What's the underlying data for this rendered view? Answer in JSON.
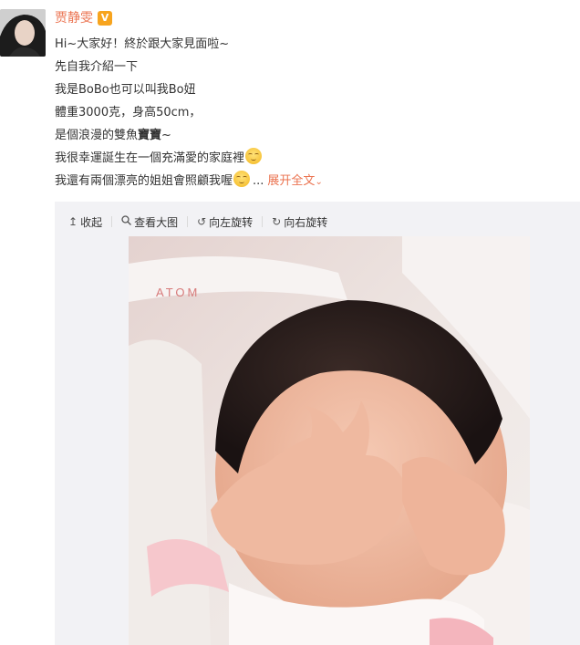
{
  "author": {
    "name": "贾静雯",
    "badge": "V"
  },
  "post": {
    "lines": [
      "Hi~大家好！終於跟大家見面啦~",
      "先自我介紹一下",
      "我是BoBo也可以叫我Bo妞",
      "體重3000克，身高50cm，",
      "是個浪漫的雙魚"
    ],
    "line5_bold": "寶寶",
    "line5_tail": "~",
    "line6": "我很幸運誕生在一個充滿愛的家庭裡",
    "line7": "我還有兩個漂亮的姐姐會照顧我喔",
    "ellipsis": "...",
    "expand_label": "展开全文",
    "expand_chevron": "⌄"
  },
  "toolbar": {
    "collapse_label": "收起",
    "view_large_label": "查看大图",
    "rotate_left_label": "向左旋转",
    "rotate_right_label": "向右旋转"
  },
  "icons": {
    "collapse": "up-arrow-icon",
    "view_large": "magnifier-icon",
    "rotate_left": "rotate-left-icon",
    "rotate_right": "rotate-right-icon",
    "emoji": "smile-emoji-icon",
    "verified": "verified-v-badge-icon"
  },
  "colors": {
    "link": "#eb7350",
    "badge": "#f7a41e",
    "panel_bg": "#f2f2f5"
  },
  "photo": {
    "logo_text": "ATOM"
  }
}
